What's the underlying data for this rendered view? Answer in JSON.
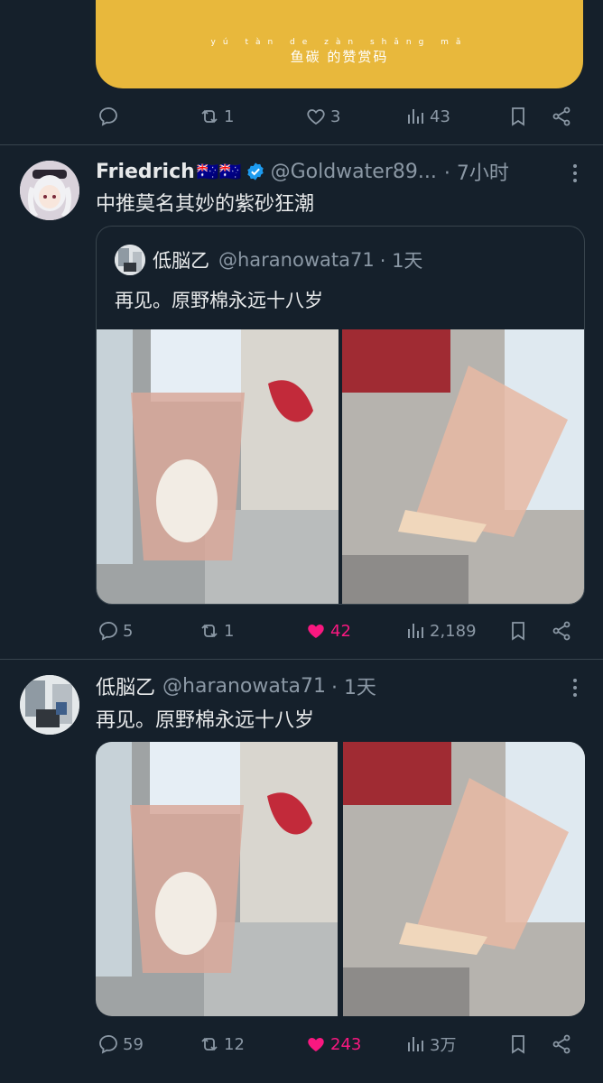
{
  "top_card": {
    "reward_ruby": "yú tàn de zàn shǎng mǎ",
    "reward_text": "鱼碳 的赞赏码",
    "replies": "",
    "reposts": "1",
    "likes": "3",
    "views": "43"
  },
  "post1": {
    "name": "Friedrich",
    "flags": "🇦🇺🇦🇺",
    "handle": "@Goldwater89...",
    "time": "· 7小时",
    "text": "中推莫名其妙的紫砂狂潮",
    "quote": {
      "name": "低脳乙",
      "handle": "@haranowata71",
      "time": "· 1天",
      "text": "再见。原野棉永远十八岁"
    },
    "replies": "5",
    "reposts": "1",
    "likes": "42",
    "views": "2,189"
  },
  "post2": {
    "name": "低脳乙",
    "handle": "@haranowata71",
    "time": "· 1天",
    "text": "再见。原野棉永远十八岁",
    "replies": "59",
    "reposts": "12",
    "likes": "243",
    "views": "3万"
  },
  "colors": {
    "background": "#15202b",
    "text": "#e7e9ea",
    "muted": "#8b98a5",
    "like": "#f91880",
    "verified": "#1d9bf0",
    "reward_card": "#e8b83c"
  }
}
